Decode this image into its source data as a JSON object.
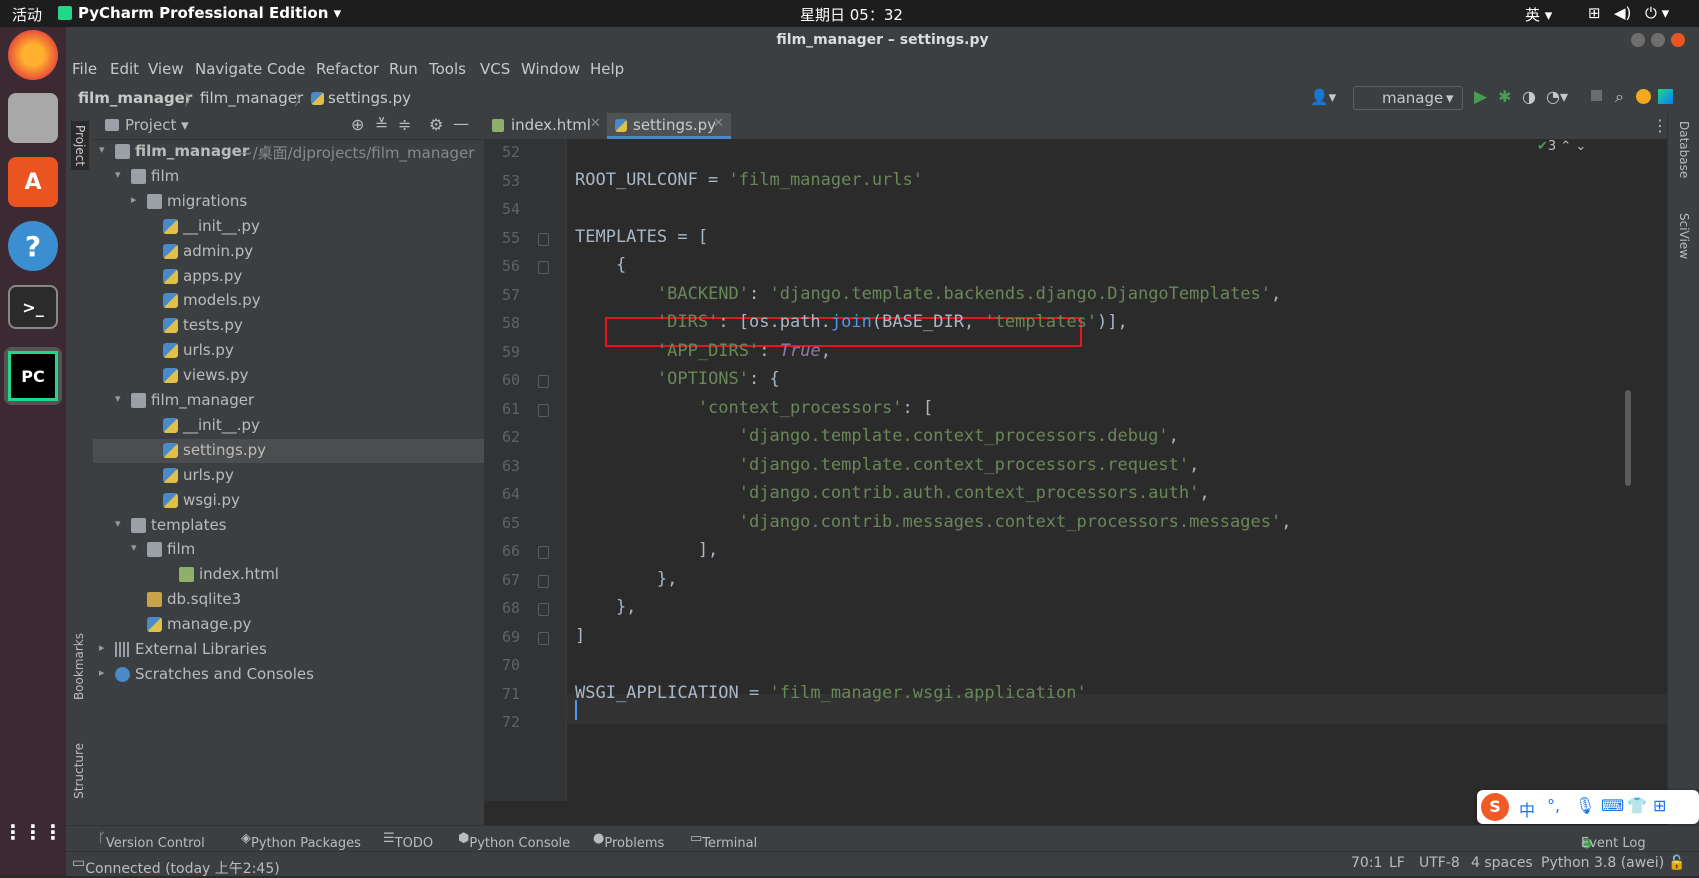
{
  "system": {
    "activities": "活动",
    "app_name": "PyCharm Professional Edition",
    "clock": "星期日 05：32",
    "input_method": "英"
  },
  "window": {
    "title": "film_manager – settings.py"
  },
  "menu": [
    "File",
    "Edit",
    "View",
    "Navigate",
    "Code",
    "Refactor",
    "Run",
    "Tools",
    "VCS",
    "Window",
    "Help"
  ],
  "breadcrumb": {
    "project": "film_manager",
    "folder": "film_manager",
    "file": "settings.py"
  },
  "run_config": "manage",
  "project_panel": {
    "title": "Project",
    "root": "film_manager",
    "root_path": "~/桌面/djprojects/film_manager",
    "items": [
      {
        "label": "film",
        "kind": "folder",
        "depth": 1,
        "arrow": "▾"
      },
      {
        "label": "migrations",
        "kind": "folder",
        "depth": 2,
        "arrow": "▸"
      },
      {
        "label": "__init__.py",
        "kind": "py",
        "depth": 3
      },
      {
        "label": "admin.py",
        "kind": "py",
        "depth": 3
      },
      {
        "label": "apps.py",
        "kind": "py",
        "depth": 3
      },
      {
        "label": "models.py",
        "kind": "py",
        "depth": 3
      },
      {
        "label": "tests.py",
        "kind": "py",
        "depth": 3
      },
      {
        "label": "urls.py",
        "kind": "py",
        "depth": 3
      },
      {
        "label": "views.py",
        "kind": "py",
        "depth": 3
      },
      {
        "label": "film_manager",
        "kind": "folder",
        "depth": 1,
        "arrow": "▾"
      },
      {
        "label": "__init__.py",
        "kind": "py",
        "depth": 3
      },
      {
        "label": "settings.py",
        "kind": "py",
        "depth": 3,
        "selected": true
      },
      {
        "label": "urls.py",
        "kind": "py",
        "depth": 3
      },
      {
        "label": "wsgi.py",
        "kind": "py",
        "depth": 3
      },
      {
        "label": "templates",
        "kind": "folder",
        "depth": 1,
        "arrow": "▾"
      },
      {
        "label": "film",
        "kind": "folder",
        "depth": 2,
        "arrow": "▾"
      },
      {
        "label": "index.html",
        "kind": "html",
        "depth": 4
      },
      {
        "label": "db.sqlite3",
        "kind": "db",
        "depth": 2
      },
      {
        "label": "manage.py",
        "kind": "py",
        "depth": 2
      },
      {
        "label": "External Libraries",
        "kind": "lib",
        "depth": 0,
        "arrow": "▸"
      },
      {
        "label": "Scratches and Consoles",
        "kind": "scratch",
        "depth": 0,
        "arrow": "▸"
      }
    ]
  },
  "tabs": [
    {
      "label": "index.html",
      "active": false
    },
    {
      "label": "settings.py",
      "active": true
    }
  ],
  "inspection_count": "3",
  "code_lines": [
    {
      "n": "52",
      "html": ""
    },
    {
      "n": "53",
      "html": "ROOT_URLCONF = <span class=\"str\">'film_manager.urls'</span>"
    },
    {
      "n": "54",
      "html": ""
    },
    {
      "n": "55",
      "html": "TEMPLATES = ["
    },
    {
      "n": "56",
      "html": "    {"
    },
    {
      "n": "57",
      "html": "        <span class=\"str\">'BACKEND'</span>: <span class=\"str\">'django.template.backends.django.DjangoTemplates'</span>,"
    },
    {
      "n": "58",
      "html": "        <span class=\"str\">'DIRS'</span>: [os.path.<span class=\"fn\">join</span>(BASE_DIR, <span class=\"str\">'templates'</span>)],"
    },
    {
      "n": "59",
      "html": "        <span class=\"str\">'APP_DIRS'</span>: <span class=\"kw\">True</span>,"
    },
    {
      "n": "60",
      "html": "        <span class=\"str\">'OPTIONS'</span>: {"
    },
    {
      "n": "61",
      "html": "            <span class=\"str\">'context_processors'</span>: ["
    },
    {
      "n": "62",
      "html": "                <span class=\"str\">'django.template.context_processors.debug'</span>,"
    },
    {
      "n": "63",
      "html": "                <span class=\"str\">'django.template.context_processors.request'</span>,"
    },
    {
      "n": "64",
      "html": "                <span class=\"str\">'django.contrib.auth.context_processors.auth'</span>,"
    },
    {
      "n": "65",
      "html": "                <span class=\"str\">'django.contrib.messages.context_processors.messages'</span>,"
    },
    {
      "n": "66",
      "html": "            ],"
    },
    {
      "n": "67",
      "html": "        },"
    },
    {
      "n": "68",
      "html": "    },"
    },
    {
      "n": "69",
      "html": "]"
    },
    {
      "n": "70",
      "html": ""
    },
    {
      "n": "71",
      "html": "WSGI_APPLICATION = <span class=\"str\">'film_manager.wsgi.application'</span>"
    },
    {
      "n": "72",
      "html": ""
    }
  ],
  "right_tools": [
    "Database",
    "SciView"
  ],
  "left_tools": [
    "Project",
    "Bookmarks",
    "Structure"
  ],
  "bottom_tools": [
    "Version Control",
    "Python Packages",
    "TODO",
    "Python Console",
    "Problems",
    "Terminal",
    "Event Log"
  ],
  "status": {
    "message": "Connected (today 上午2:45)",
    "position": "70:1",
    "line_sep": "LF",
    "encoding": "UTF-8",
    "indent": "4 spaces",
    "interpreter": "Python 3.8 (awei)"
  },
  "ime_label": "中"
}
